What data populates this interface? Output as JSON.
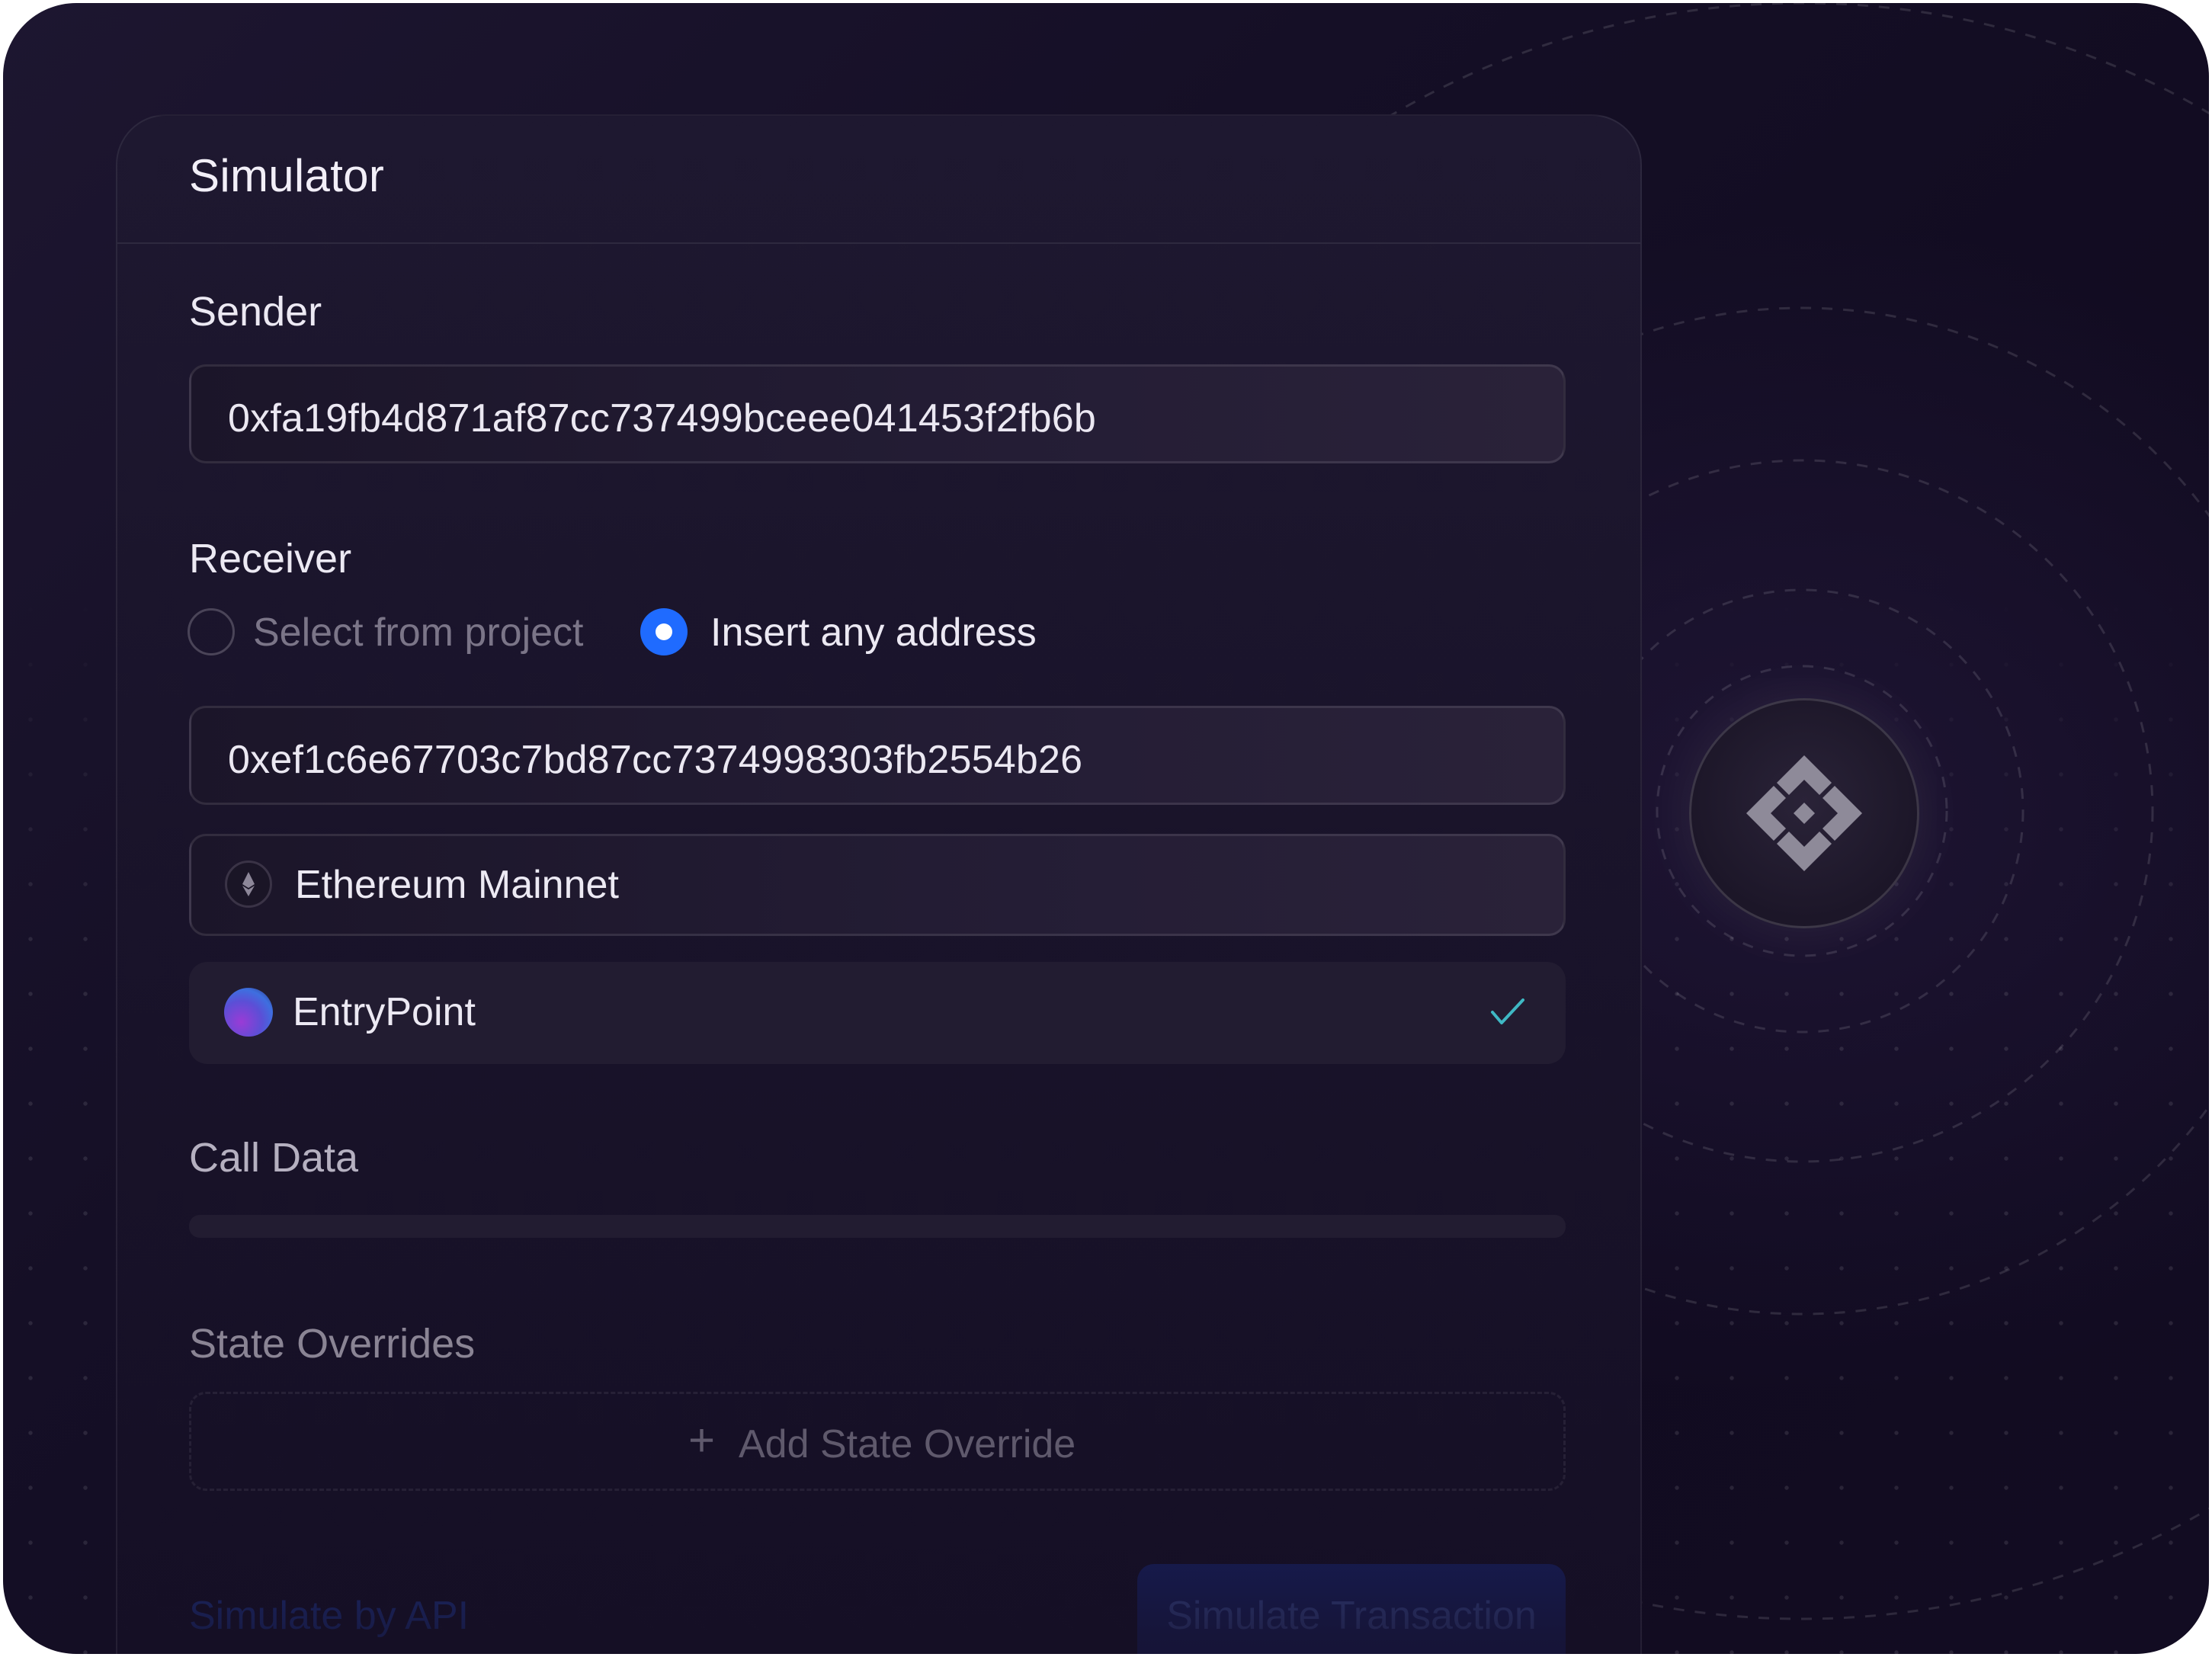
{
  "panel": {
    "title": "Simulator"
  },
  "sender": {
    "label": "Sender",
    "address": "0xfa19fb4d871af87cc737499bceee041453f2fb6b"
  },
  "receiver": {
    "label": "Receiver",
    "options": [
      {
        "label": "Select from project",
        "selected": false
      },
      {
        "label": "Insert any address",
        "selected": true
      }
    ],
    "address": "0xef1c6e67703c7bd87cc7374998303fb2554b26",
    "network": {
      "label": "Ethereum Mainnet",
      "icon": "ethereum-icon"
    },
    "contract": {
      "label": "EntryPoint",
      "icon": "contract-avatar-icon",
      "status_icon": "checkmark-icon"
    }
  },
  "call_data": {
    "label": "Call Data"
  },
  "state_overrides": {
    "label": "State Overrides",
    "add_label": "Add State Override",
    "add_icon": "plus-icon"
  },
  "footer": {
    "api_link": "Simulate by API",
    "simulate_button": "Simulate Transaction"
  },
  "side_logo": {
    "icon": "binance-logo-icon"
  },
  "colors": {
    "background": "#130d24",
    "panel": "#1c162d",
    "accent_blue": "#1f6bff",
    "check_teal": "#3fb8c4",
    "text_primary": "#ece9f3",
    "text_muted": "#7b7588"
  }
}
